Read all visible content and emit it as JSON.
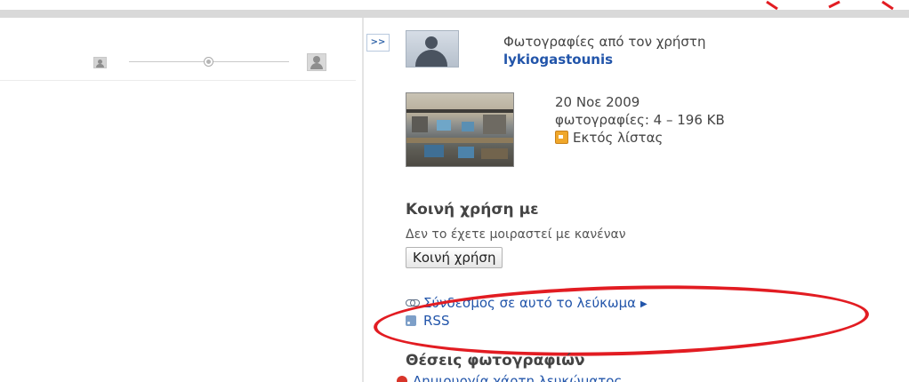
{
  "sidebar": {
    "expand_label": ">>",
    "owner": {
      "caption": "Φωτογραφίες από τον χρήστη",
      "username": "lykiogastounis"
    },
    "album": {
      "date": "20 Νοε 2009",
      "info": "φωτογραφίες: 4 – 196 KB",
      "visibility": "Εκτός λίστας"
    },
    "sharing": {
      "heading": "Κοινή χρήση με",
      "status": "Δεν το έχετε μοιραστεί με κανέναν",
      "button_label": "Κοινή χρήση"
    },
    "links": {
      "album_link": "Σύνδεσμος σε αυτό το λεύκωμα",
      "rss": "RSS"
    },
    "places": {
      "heading": "Θέσεις φωτογραφιών",
      "link": "Δημιουργία χάρτη λευκώματος"
    }
  },
  "colors": {
    "link": "#2255aa",
    "annotation": "#e21c22",
    "lock": "#f0a72a"
  },
  "icons": [
    "person-small-icon",
    "person-large-icon",
    "lock-icon",
    "chain-link-icon",
    "triangle-right-icon",
    "rss-icon",
    "map-pin-icon"
  ]
}
